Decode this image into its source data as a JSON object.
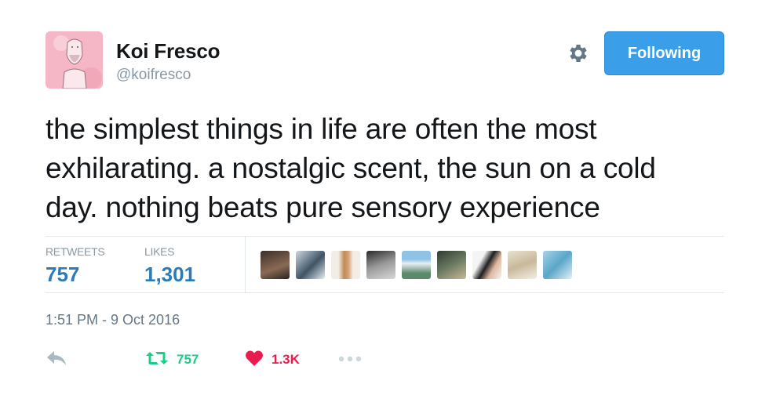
{
  "author": {
    "name": "Koi Fresco",
    "handle": "@koifresco"
  },
  "header": {
    "follow_label": "Following"
  },
  "tweet": {
    "lines": [
      "the simplest things in life are often the most",
      "exhilarating. a nostalgic scent, the sun on a cold",
      "day. nothing beats pure sensory experience"
    ],
    "timestamp": "1:51 PM - 9 Oct 2016"
  },
  "stats": {
    "retweets_label": "RETWEETS",
    "retweets_value": "757",
    "likes_label": "LIKES",
    "likes_value": "1,301"
  },
  "actions": {
    "retweet_count": "757",
    "like_count": "1.3K"
  },
  "colors": {
    "follow_button": "#3b9ee8",
    "stat_value": "#2b7bb9",
    "retweet_green": "#19cf86",
    "like_red": "#e81c4f",
    "muted": "#8899a6"
  },
  "icons": {
    "settings": "gear-icon",
    "reply": "reply-icon",
    "retweet": "retweet-icon",
    "like": "heart-icon",
    "more": "more-icon"
  }
}
